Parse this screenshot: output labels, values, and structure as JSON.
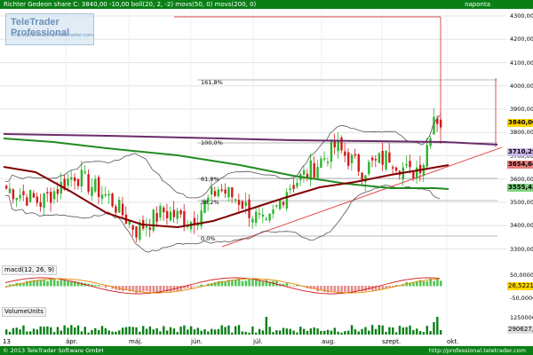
{
  "header": {
    "title": "Richter Gedeon share  C: 3840,00  -10,00  boll(20, 2, -2)  movs(50, 0)  movs(200, 0)",
    "period": "naponta"
  },
  "logo": {
    "name": "TeleTrader Professional",
    "url": "http://professional.teletrader.com"
  },
  "price_axis": {
    "ticks": [
      "4300,00",
      "4200,00",
      "4100,00",
      "4000,00",
      "3900,00",
      "3800,00",
      "3700,00",
      "3600,00",
      "3500,00",
      "3400,00",
      "3300,00"
    ]
  },
  "price_boxes": {
    "close": {
      "label": "3840,00",
      "color": "#ffd700"
    },
    "ma_purple": {
      "label": "3710,29",
      "color": "#c9b8e8"
    },
    "ma_red": {
      "label": "3654,64",
      "color": "#e97a7a"
    },
    "ma_green": {
      "label": "3555,43",
      "color": "#7fd17f"
    }
  },
  "fib_levels": [
    "161,8%",
    "100,0%",
    "61,8%",
    "38,2%",
    "0,0%"
  ],
  "macd": {
    "title": "macd(12, 26, 9)",
    "ticks": [
      "50,0000",
      "-50,0000"
    ],
    "value_box": {
      "label": "26,5221",
      "color": "#ffd700"
    }
  },
  "volume": {
    "title": "VolumeUnits",
    "ticks": [
      "1250000"
    ],
    "value_box": {
      "label": "290627,0",
      "color": "#e0e0e0"
    }
  },
  "x_axis": {
    "labels": [
      "13",
      "ápr.",
      "máj.",
      "jún.",
      "júl.",
      "aug.",
      "szept.",
      "okt."
    ]
  },
  "footer": {
    "copyright": "© 2013 TeleTrader Software GmbH",
    "url": "http://professional.teletrader.com"
  },
  "colors": {
    "up": "#2bb52b",
    "down": "#d21919",
    "ma200": "#228b22",
    "ma50": "#800000",
    "boll": "#555555",
    "long_ma": "#6b2c6b",
    "bars": "#0a7f16"
  }
}
